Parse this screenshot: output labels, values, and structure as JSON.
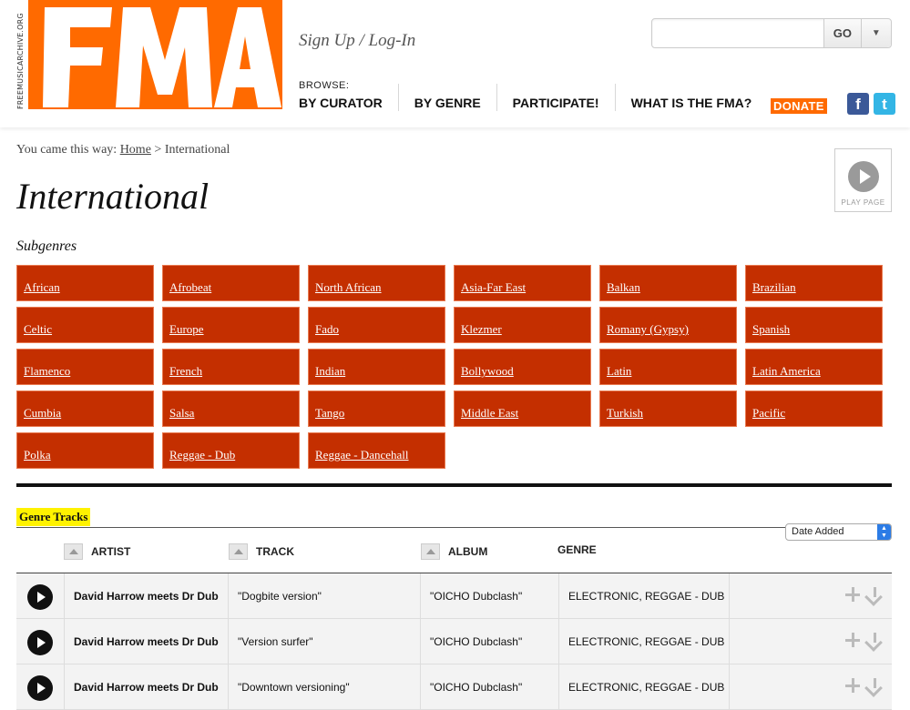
{
  "header": {
    "logo_side_text": "FREEMUSICARCHIVE.ORG",
    "logo_text": "FMA",
    "sign_up": "Sign Up",
    "separator": "/",
    "log_in": "Log-In",
    "browse_label": "BROWSE:",
    "nav": [
      "BY CURATOR",
      "BY GENRE",
      "PARTICIPATE!",
      "WHAT IS THE FMA?"
    ],
    "donate": "DONATE",
    "search_value": "",
    "search_go": "GO",
    "facebook_icon": "f",
    "twitter_icon": "t",
    "colors": {
      "brand": "#ff6a00"
    }
  },
  "breadcrumb": {
    "prefix": "You came this way:",
    "home": "Home",
    "sep": ">",
    "current": "International"
  },
  "page_title": "International",
  "play_page_label": "PLAY PAGE",
  "subgenres_title": "Subgenres",
  "subgenres": [
    "African",
    "Afrobeat",
    "North African",
    "Asia-Far East",
    "Balkan",
    "Brazilian",
    "Celtic",
    "Europe",
    "Fado",
    "Klezmer",
    "Romany (Gypsy)",
    "Spanish",
    "Flamenco",
    "French",
    "Indian",
    "Bollywood",
    "Latin",
    "Latin America",
    "Cumbia",
    "Salsa",
    "Tango",
    "Middle East",
    "Turkish",
    "Pacific",
    "Polka",
    "Reggae - Dub",
    "Reggae - Dancehall"
  ],
  "subgenre_color": "#c42f00",
  "tracks": {
    "section_label": "Genre Tracks",
    "sort_value": "Date Added",
    "columns": {
      "artist": "ARTIST",
      "track": "TRACK",
      "album": "ALBUM",
      "genre": "GENRE"
    },
    "rows": [
      {
        "artist": "David Harrow meets Dr Dub",
        "track": "\"Dogbite version\"",
        "album": "\"OICHO Dubclash\"",
        "genre": "ELECTRONIC, REGGAE - DUB"
      },
      {
        "artist": "David Harrow meets Dr Dub",
        "track": "\"Version surfer\"",
        "album": "\"OICHO Dubclash\"",
        "genre": "ELECTRONIC, REGGAE - DUB"
      },
      {
        "artist": "David Harrow meets Dr Dub",
        "track": "\"Downtown versioning\"",
        "album": "\"OICHO Dubclash\"",
        "genre": "ELECTRONIC, REGGAE - DUB"
      }
    ]
  }
}
